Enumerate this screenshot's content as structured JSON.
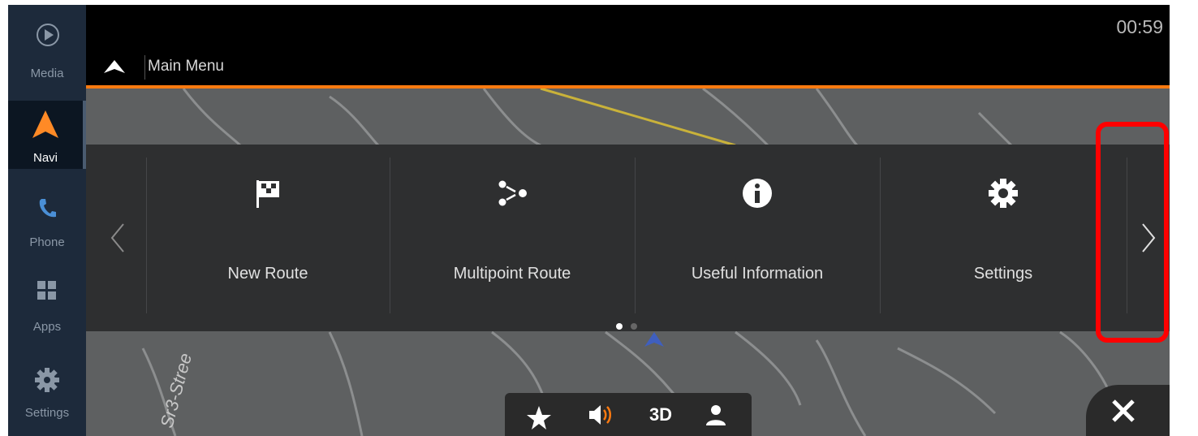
{
  "clock": "00:59",
  "header": {
    "title": "Main Menu"
  },
  "sidebar": {
    "items": [
      {
        "label": "Media",
        "icon": "play-circle-icon"
      },
      {
        "label": "Navi",
        "icon": "navigation-arrow-icon",
        "active": true
      },
      {
        "label": "Phone",
        "icon": "phone-icon"
      },
      {
        "label": "Apps",
        "icon": "apps-grid-icon"
      },
      {
        "label": "Settings",
        "icon": "gear-icon"
      }
    ]
  },
  "menu": {
    "items": [
      {
        "label": "New Route",
        "icon": "checkered-flag-icon"
      },
      {
        "label": "Multipoint Route",
        "icon": "multipoint-route-icon"
      },
      {
        "label": "Useful Information",
        "icon": "info-icon"
      },
      {
        "label": "Settings",
        "icon": "gear-icon"
      }
    ],
    "page_count": 2,
    "current_page": 1
  },
  "map": {
    "street_label": "Sr3-Stree"
  },
  "toolbar": {
    "view_mode_label": "3D",
    "buttons": [
      "star-icon",
      "volume-icon",
      "3D",
      "person-icon"
    ]
  },
  "colors": {
    "accent": "#ff7a10",
    "sidebar_bg": "#1d2a3b",
    "panel_bg": "#2e2f30",
    "map_bg": "#5e6061",
    "highlight": "#ff0000"
  }
}
